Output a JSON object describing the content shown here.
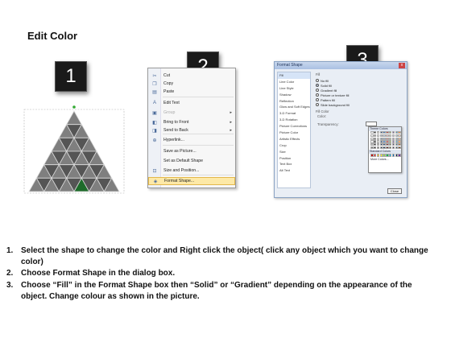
{
  "title": "Edit Color",
  "badges": [
    "1",
    "2",
    "3"
  ],
  "context_menu": {
    "items": [
      {
        "label": "Cut",
        "icon": "scissors-icon",
        "glyph": "✂"
      },
      {
        "label": "Copy",
        "icon": "copy-icon",
        "glyph": "❐"
      },
      {
        "label": "Paste",
        "icon": "paste-icon",
        "glyph": "▤"
      },
      {
        "label": "Edit Text",
        "icon": "edit-text-icon",
        "glyph": "A"
      },
      {
        "label": "Group",
        "icon": "group-icon",
        "glyph": "▣",
        "disabled": true,
        "submenu": true
      },
      {
        "label": "Bring to Front",
        "icon": "bring-front-icon",
        "glyph": "◧",
        "submenu": true
      },
      {
        "label": "Send to Back",
        "icon": "send-back-icon",
        "glyph": "◨",
        "submenu": true
      },
      {
        "label": "Hyperlink...",
        "icon": "hyperlink-icon",
        "glyph": "⊕"
      },
      {
        "label": "Save as Picture...",
        "icon": "",
        "glyph": ""
      },
      {
        "label": "Set as Default Shape",
        "icon": "",
        "glyph": ""
      },
      {
        "label": "Size and Position...",
        "icon": "size-icon",
        "glyph": "⊡"
      },
      {
        "label": "Format Shape...",
        "icon": "format-shape-icon",
        "glyph": "◈",
        "highlight": true
      }
    ]
  },
  "dialog": {
    "title": "Format Shape",
    "close": "x",
    "categories": [
      "Fill",
      "Line Color",
      "Line Style",
      "Shadow",
      "Reflection",
      "Glow and Soft Edges",
      "3-D Format",
      "3-D Rotation",
      "Picture Corrections",
      "Picture Color",
      "Artistic Effects",
      "Crop",
      "Size",
      "Position",
      "Text Box",
      "Alt Text"
    ],
    "section": "Fill",
    "options": [
      "No fill",
      "Solid fill",
      "Gradient fill",
      "Picture or texture fill",
      "Pattern fill",
      "Slide background fill"
    ],
    "selected_option": "Solid fill",
    "fill_color_label": "Fill Color",
    "color_label": "Color:",
    "transparency_label": "Transparency:",
    "theme_colors_label": "Theme Colors",
    "standard_colors_label": "Standard Colors",
    "more_colors_label": "More Colors...",
    "close_button": "Close",
    "theme_colors": [
      "#ffffff",
      "#000000",
      "#eeece1",
      "#1f497d",
      "#4f81bd",
      "#c0504d",
      "#9bbb59",
      "#8064a2",
      "#4bacc6",
      "#f79646"
    ],
    "standard_colors": [
      "#c00000",
      "#ff0000",
      "#ffc000",
      "#ffff00",
      "#92d050",
      "#00b050",
      "#00b0f0",
      "#0070c0",
      "#002060",
      "#7030a0"
    ]
  },
  "pyramid": {
    "fill": "#7f7f7f",
    "highlight": "#1d6b2a",
    "edge": "#555555"
  },
  "steps": [
    {
      "num": "1.",
      "text": "Select the shape to change the color and Right click the object( click any object which you want to change color)"
    },
    {
      "num": "2.",
      "text": "Choose Format Shape in the dialog box."
    },
    {
      "num": "3.",
      "text": "Choose “Fill” in the Format Shape box then “Solid” or “Gradient” depending on the appearance of the object. Change colour as shown in the picture."
    }
  ]
}
